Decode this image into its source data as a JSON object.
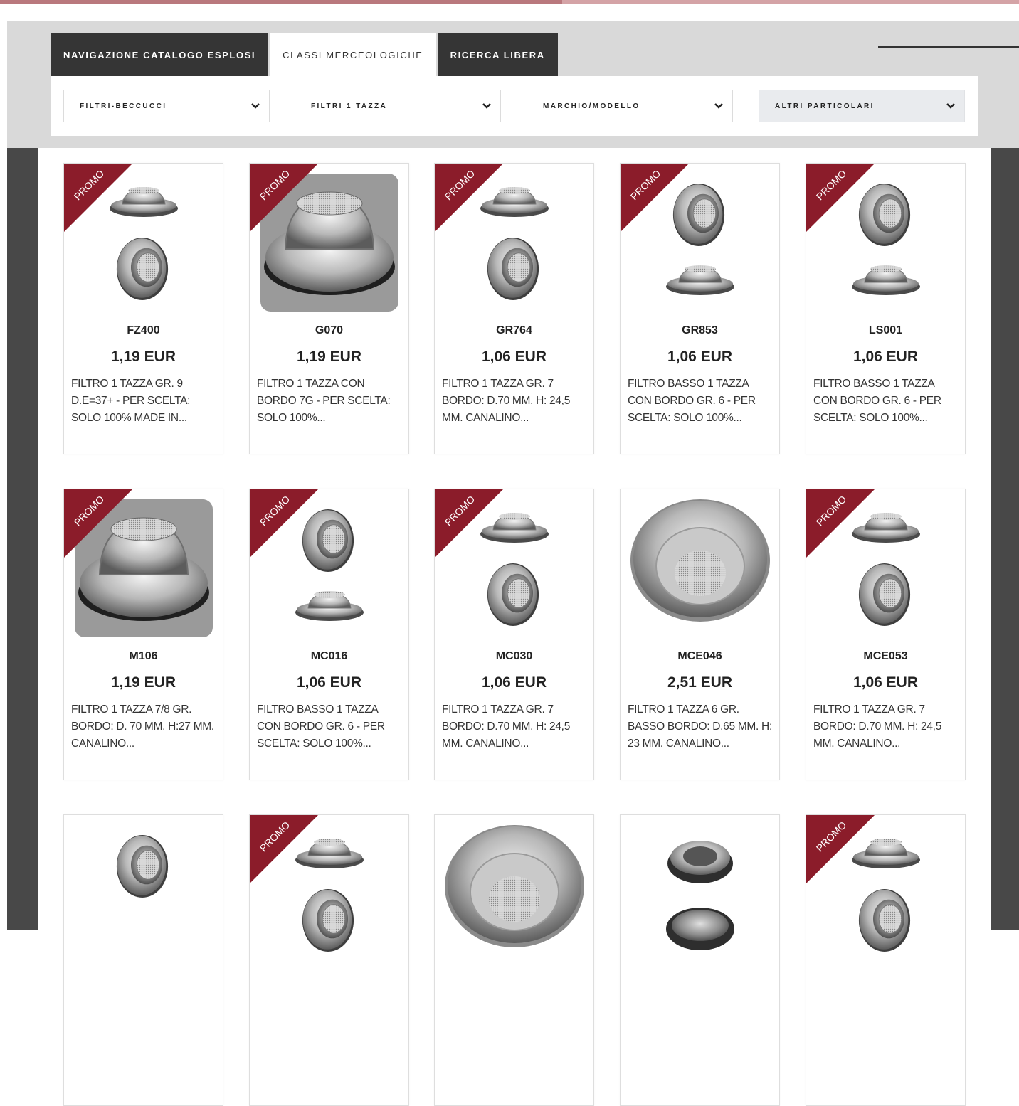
{
  "tabs": [
    {
      "label": "NAVIGAZIONE CATALOGO ESPLOSI"
    },
    {
      "label": "CLASSI MERCEOLOGICHE"
    },
    {
      "label": "RICERCA LIBERA"
    }
  ],
  "filters": [
    {
      "value": "FILTRI-BECCUCCI",
      "icon": "chevron-down-icon"
    },
    {
      "value": "FILTRI 1 TAZZA",
      "icon": "chevron-down-icon"
    },
    {
      "value": "MARCHIO/MODELLO",
      "icon": "chevron-down-icon"
    },
    {
      "value": "ALTRI PARTICOLARI",
      "icon": "chevron-down-icon"
    }
  ],
  "promo_label": "PROMO",
  "colors": {
    "promo": "#8b1c2a",
    "tab_dark": "#353535",
    "frame_dark": "#484848"
  },
  "products": [
    {
      "code": "FZ400",
      "price": "1,19 EUR",
      "desc": "FILTRO 1 TAZZA GR. 9 D.E=37+ - PER SCELTA: SOLO 100% MADE IN...",
      "promo": true,
      "image": "filter-pair-icon"
    },
    {
      "code": "G070",
      "price": "1,19 EUR",
      "desc": "FILTRO 1 TAZZA CON BORDO 7G - PER SCELTA: SOLO 100%...",
      "promo": true,
      "image": "filter-photo-icon"
    },
    {
      "code": "GR764",
      "price": "1,06 EUR",
      "desc": "FILTRO 1 TAZZA GR. 7 BORDO: D.70 MM. H: 24,5 MM. CANALINO...",
      "promo": true,
      "image": "filter-pair-icon"
    },
    {
      "code": "GR853",
      "price": "1,06 EUR",
      "desc": "FILTRO BASSO 1 TAZZA CON BORDO GR. 6 - PER SCELTA: SOLO 100%...",
      "promo": true,
      "image": "filter-pair-reverse-icon"
    },
    {
      "code": "LS001",
      "price": "1,06 EUR",
      "desc": "FILTRO BASSO 1 TAZZA CON BORDO GR. 6 - PER SCELTA: SOLO 100%...",
      "promo": true,
      "image": "filter-pair-reverse-icon"
    },
    {
      "code": "M106",
      "price": "1,19 EUR",
      "desc": "FILTRO 1 TAZZA 7/8 GR. BORDO: D. 70 MM. H:27 MM. CANALINO...",
      "promo": true,
      "image": "filter-photo-icon"
    },
    {
      "code": "MC016",
      "price": "1,06 EUR",
      "desc": "FILTRO BASSO 1 TAZZA CON BORDO GR. 6 - PER SCELTA: SOLO 100%...",
      "promo": true,
      "image": "filter-pair-reverse-icon"
    },
    {
      "code": "MC030",
      "price": "1,06 EUR",
      "desc": "FILTRO 1 TAZZA GR. 7 BORDO: D.70 MM. H: 24,5 MM. CANALINO...",
      "promo": true,
      "image": "filter-pair-icon"
    },
    {
      "code": "MCE046",
      "price": "2,51 EUR",
      "desc": "FILTRO 1 TAZZA 6 GR. BASSO BORDO: D.65 MM. H: 23 MM. CANALINO...",
      "promo": false,
      "image": "filter-bowl-icon"
    },
    {
      "code": "MCE053",
      "price": "1,06 EUR",
      "desc": "FILTRO 1 TAZZA GR. 7 BORDO: D.70 MM. H: 24,5 MM. CANALINO...",
      "promo": true,
      "image": "filter-pair-icon"
    },
    {
      "code": "",
      "price": "",
      "desc": "",
      "promo": false,
      "image": "filter-single-icon"
    },
    {
      "code": "",
      "price": "",
      "desc": "",
      "promo": true,
      "image": "filter-pair-icon"
    },
    {
      "code": "",
      "price": "",
      "desc": "",
      "promo": false,
      "image": "filter-bowl-icon"
    },
    {
      "code": "",
      "price": "",
      "desc": "",
      "promo": false,
      "image": "filter-dark-icon"
    },
    {
      "code": "",
      "price": "",
      "desc": "",
      "promo": true,
      "image": "filter-pair-icon"
    }
  ]
}
